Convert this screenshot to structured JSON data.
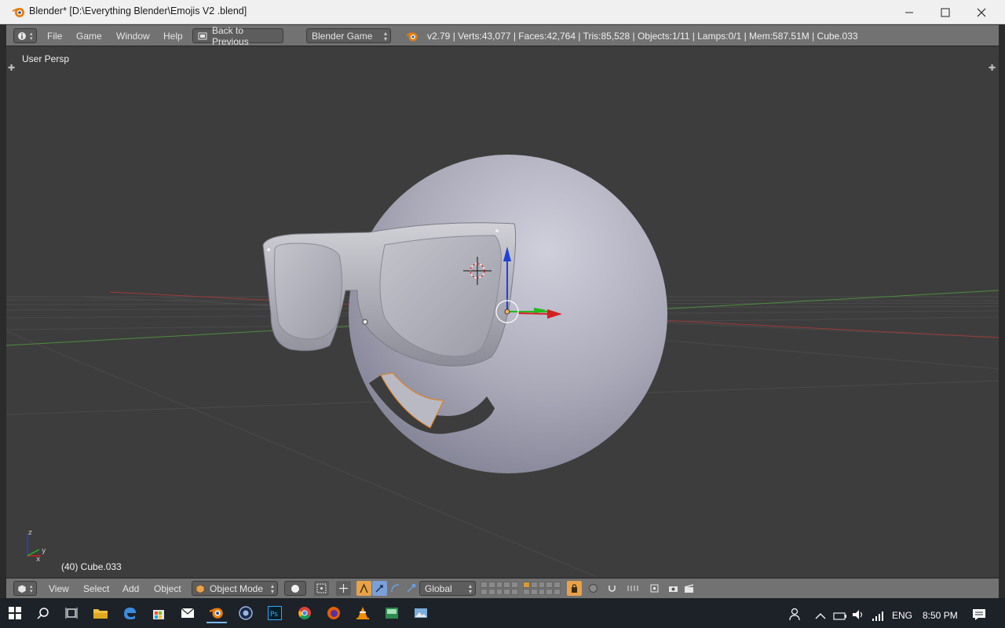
{
  "window": {
    "title": "Blender* [D:\\Everything Blender\\Emojis V2 .blend]"
  },
  "info_header": {
    "menus": [
      "File",
      "Game",
      "Window",
      "Help"
    ],
    "back_label": "Back to Previous",
    "engine": "Blender Game",
    "stats": "v2.79 | Verts:43,077 | Faces:42,764 | Tris:85,528 | Objects:1/11 | Lamps:0/1 | Mem:587.51M | Cube.033"
  },
  "viewport": {
    "view_name": "User Persp",
    "object_info": "(40) Cube.033",
    "axis_labels": {
      "x": "x",
      "y": "y",
      "z": "z"
    }
  },
  "view_header": {
    "menus": [
      "View",
      "Select",
      "Add",
      "Object"
    ],
    "mode": "Object Mode",
    "orientation": "Global"
  },
  "taskbar": {
    "language": "ENG",
    "time": "8:50 PM"
  },
  "colors": {
    "accent_orange": "#e87d0d",
    "manipulator_x": "#d42020",
    "manipulator_y": "#24b824",
    "manipulator_z": "#2040d8",
    "viewport_bg": "#3d3d3d"
  }
}
